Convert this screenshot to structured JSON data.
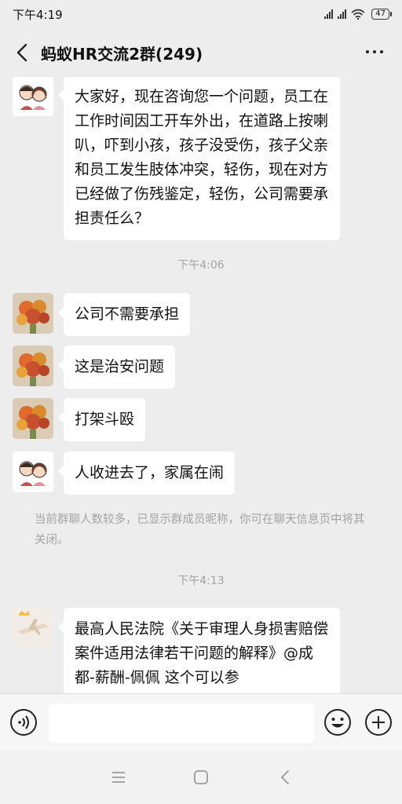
{
  "status_bar": {
    "time": "下午4:19",
    "battery": "47"
  },
  "header": {
    "title": "蚂蚁HR交流2群(249)"
  },
  "messages": [
    {
      "text": "大家好，现在咨询您一个问题，员工在工作时间因工开车外出，在道路上按喇叭，吓到小孩，孩子没受伤，孩子父亲和员工发生肢体冲突，轻伤，现在对方已经做了伤残鉴定，轻伤，公司需要承担责任么？"
    },
    {
      "text": "公司不需要承担"
    },
    {
      "text": "这是治安问题"
    },
    {
      "text": "打架斗殴"
    },
    {
      "text": "人收进去了，家属在闹"
    },
    {
      "text": "最高人民法院《关于审理人身损害赔偿案件适用法律若干问题的解释》@成都-薪酬-佩佩 这个可以参"
    }
  ],
  "timestamps": {
    "t1": "下午4:06",
    "t2": "下午4:13"
  },
  "system_note": "当前群聊人数较多，已显示群成员昵称，你可在聊天信息页中将其关闭。",
  "input": {
    "value": ""
  },
  "icons": {
    "back": "chevron-left-icon",
    "more": "more-icon",
    "voice": "voice-icon",
    "emoji": "emoji-icon",
    "plus": "plus-icon",
    "nav_menu": "menu-icon",
    "nav_home": "home-icon",
    "nav_back": "back-icon"
  },
  "colors": {
    "background": "#ededed",
    "bubble": "#ffffff",
    "muted_text": "#a3a3a3"
  }
}
